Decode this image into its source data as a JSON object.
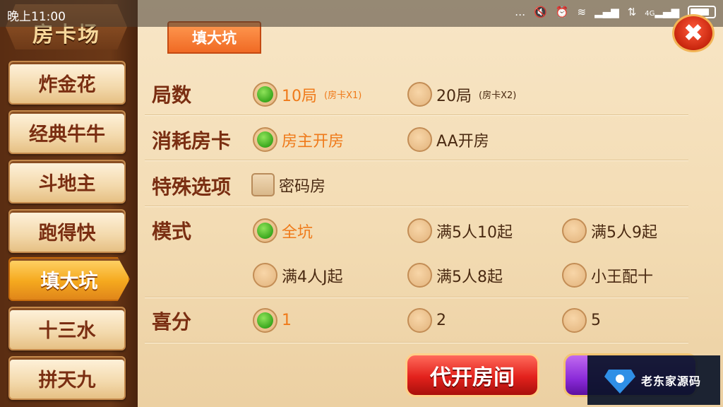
{
  "status_bar": {
    "time": "晚上11:00",
    "icons": [
      "more-dots-icon",
      "mute-icon",
      "alarm-icon",
      "wifi-icon",
      "signal-icon",
      "data-arrows-icon",
      "signal-4g-icon",
      "battery-icon"
    ],
    "network_label": "4G"
  },
  "sidebar": {
    "header": "房卡场",
    "items": [
      {
        "label": "炸金花",
        "active": false
      },
      {
        "label": "经典牛牛",
        "active": false
      },
      {
        "label": "斗地主",
        "active": false
      },
      {
        "label": "跑得快",
        "active": false
      },
      {
        "label": "填大坑",
        "active": true
      },
      {
        "label": "十三水",
        "active": false
      },
      {
        "label": "拼天九",
        "active": false
      }
    ]
  },
  "tab": {
    "label": "填大坑"
  },
  "form": {
    "rounds": {
      "label": "局数",
      "options": [
        {
          "label": "10局",
          "sub": "(房卡X1)",
          "selected": true
        },
        {
          "label": "20局",
          "sub": "(房卡X2)",
          "selected": false
        }
      ]
    },
    "cost": {
      "label": "消耗房卡",
      "options": [
        {
          "label": "房主开房",
          "selected": true
        },
        {
          "label": "AA开房",
          "selected": false
        }
      ]
    },
    "special": {
      "label": "特殊选项",
      "options": [
        {
          "label": "密码房",
          "checked": false
        }
      ]
    },
    "mode": {
      "label": "模式",
      "options": [
        {
          "label": "全坑",
          "selected": true
        },
        {
          "label": "满5人10起",
          "selected": false
        },
        {
          "label": "满5人9起",
          "selected": false
        },
        {
          "label": "满4人J起",
          "selected": false
        },
        {
          "label": "满5人8起",
          "selected": false
        },
        {
          "label": "小王配十",
          "selected": false
        }
      ]
    },
    "bonus": {
      "label": "喜分",
      "options": [
        {
          "label": "1",
          "selected": true
        },
        {
          "label": "2",
          "selected": false
        },
        {
          "label": "5",
          "selected": false
        }
      ]
    }
  },
  "buttons": {
    "open_for_others": "代开房间"
  },
  "watermark": {
    "text": "老东家源码"
  },
  "colors": {
    "accent_orange": "#ef7a1a",
    "label_brown": "#7a2e12",
    "radio_green": "#3aa81e",
    "close_red": "#c8260e",
    "purple_button": "#8a2ad8"
  }
}
